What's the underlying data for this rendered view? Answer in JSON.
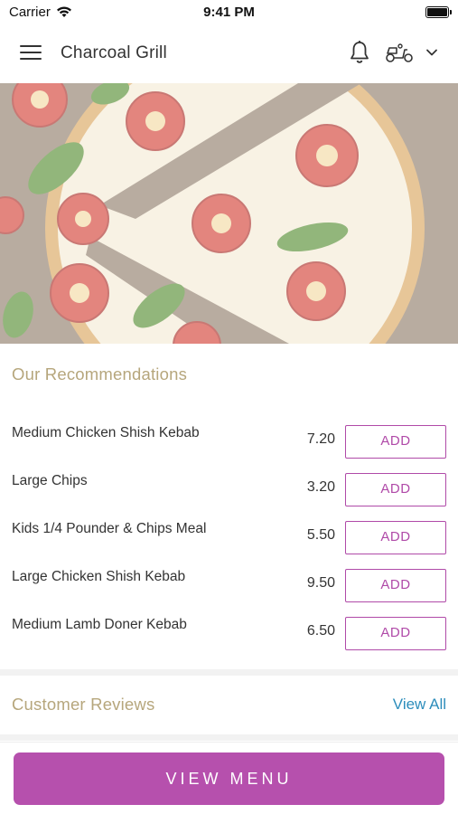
{
  "status_bar": {
    "carrier": "Carrier",
    "time": "9:41 PM"
  },
  "app_bar": {
    "title": "Charcoal Grill"
  },
  "recommendations": {
    "title": "Our Recommendations",
    "items": [
      {
        "name": "Medium Chicken Shish Kebab",
        "price": "7.20",
        "action": "ADD"
      },
      {
        "name": "Large Chips",
        "price": "3.20",
        "action": "ADD"
      },
      {
        "name": "Kids 1/4 Pounder & Chips Meal",
        "price": "5.50",
        "action": "ADD"
      },
      {
        "name": "Large Chicken Shish Kebab",
        "price": "9.50",
        "action": "ADD"
      },
      {
        "name": "Medium Lamb Doner Kebab",
        "price": "6.50",
        "action": "ADD"
      }
    ]
  },
  "reviews": {
    "title": "Customer Reviews",
    "view_all": "View All"
  },
  "footer": {
    "view_menu": "VIEW MENU"
  },
  "colors": {
    "accent": "#b650ad",
    "section_title": "#b6a67c",
    "link": "#2d8dbb"
  },
  "icons": {
    "menu": "hamburger-icon",
    "notifications": "bell-icon",
    "delivery": "scooter-icon",
    "dropdown": "chevron-down-icon"
  }
}
